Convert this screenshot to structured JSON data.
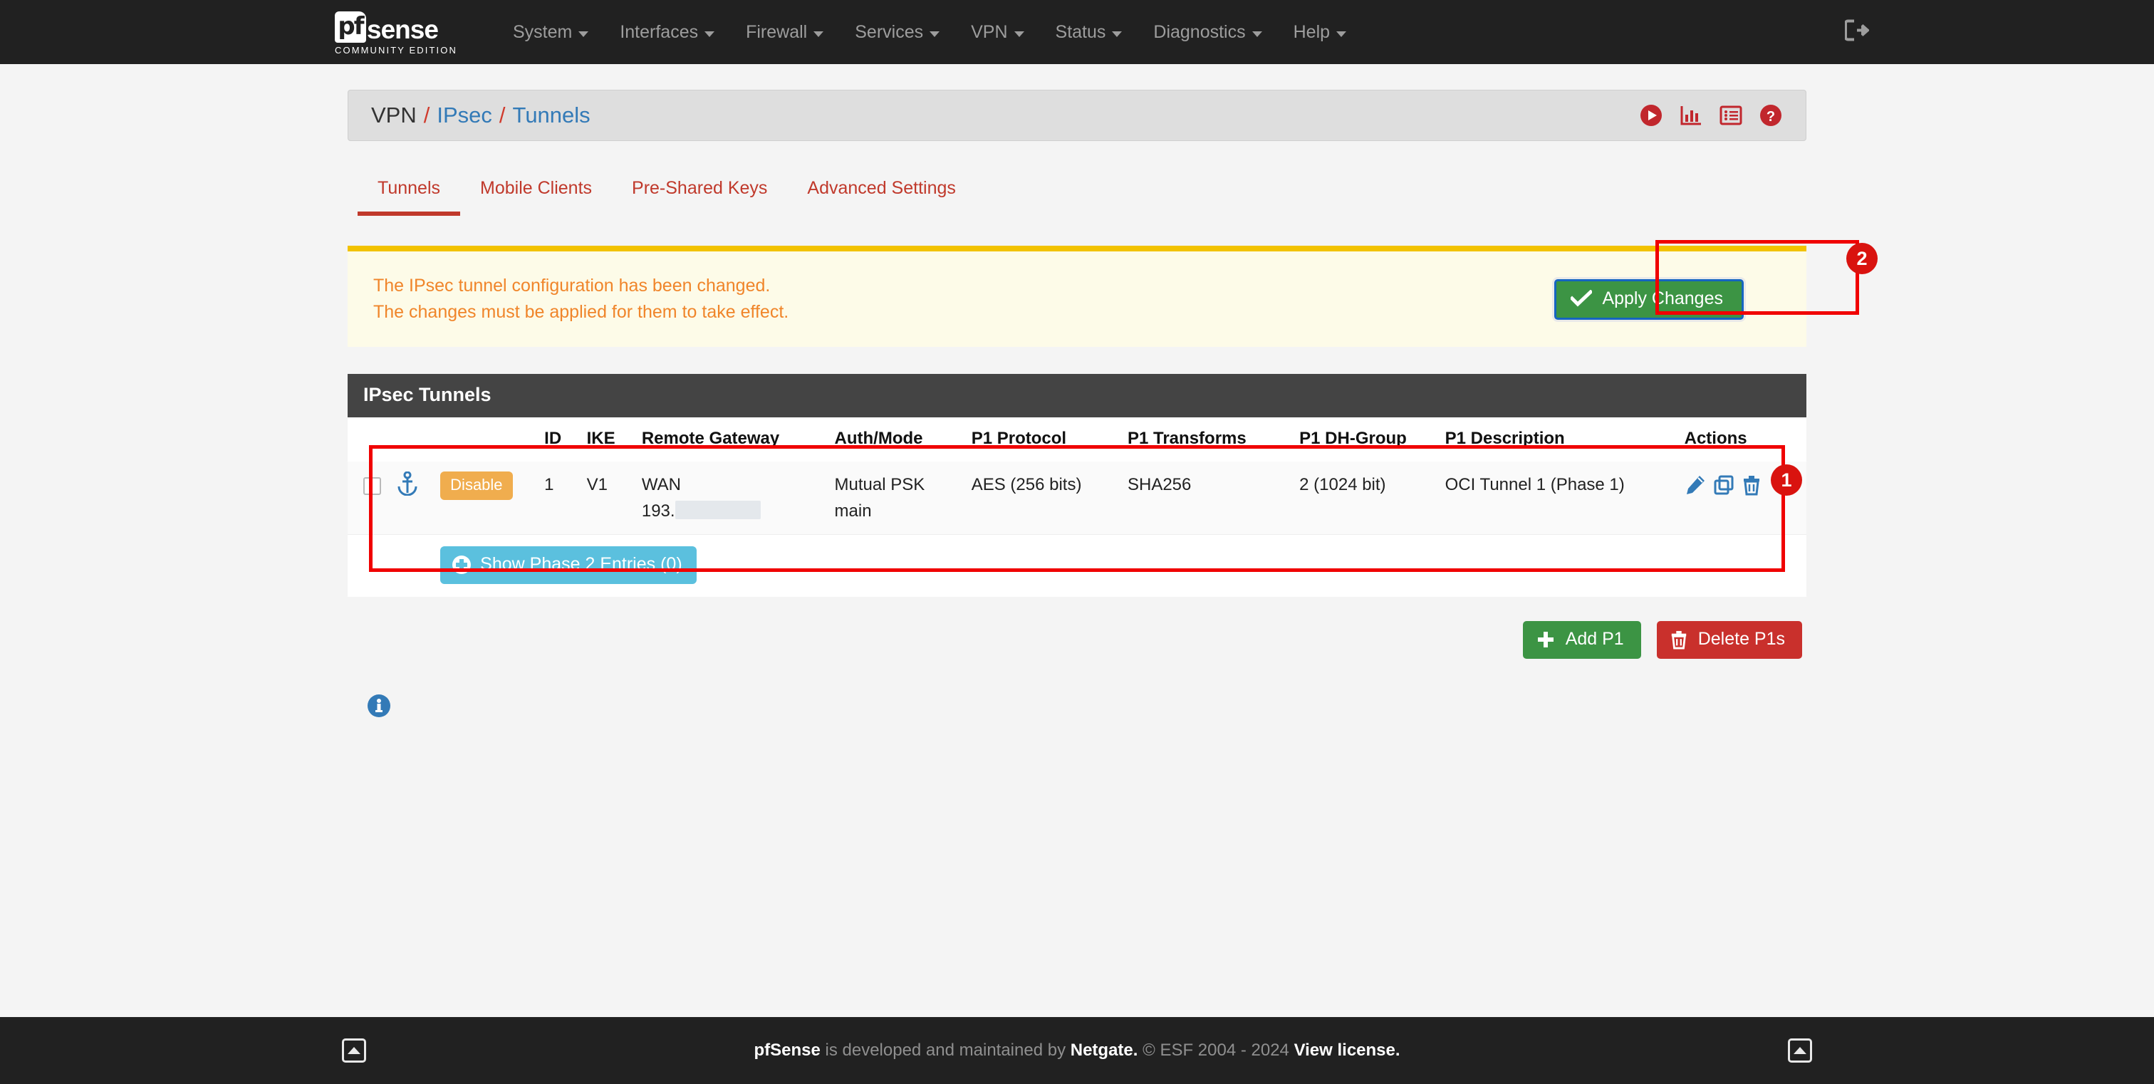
{
  "navbar": {
    "brand_mark": "pf",
    "brand_word": "sense",
    "brand_sub": "COMMUNITY EDITION",
    "logout_icon": "sign-out-icon",
    "items": [
      {
        "label": "System"
      },
      {
        "label": "Interfaces"
      },
      {
        "label": "Firewall"
      },
      {
        "label": "Services"
      },
      {
        "label": "VPN"
      },
      {
        "label": "Status"
      },
      {
        "label": "Diagnostics"
      },
      {
        "label": "Help"
      }
    ]
  },
  "header": {
    "crumb_root": "VPN",
    "crumb_mid": "IPsec",
    "crumb_leaf": "Tunnels",
    "separator": "/",
    "icons": [
      {
        "name": "play-circle-icon"
      },
      {
        "name": "bar-chart-icon"
      },
      {
        "name": "logs-list-icon"
      },
      {
        "name": "help-circle-icon"
      }
    ]
  },
  "tabs": [
    {
      "label": "Tunnels",
      "active": true
    },
    {
      "label": "Mobile Clients",
      "active": false
    },
    {
      "label": "Pre-Shared Keys",
      "active": false
    },
    {
      "label": "Advanced Settings",
      "active": false
    }
  ],
  "alert": {
    "line1": "The IPsec tunnel configuration has been changed.",
    "line2": "The changes must be applied for them to take effect.",
    "apply_label": "Apply Changes",
    "apply_icon": "check-icon"
  },
  "panel": {
    "title": "IPsec Tunnels",
    "columns": [
      "",
      "",
      "",
      "ID",
      "IKE",
      "Remote Gateway",
      "Auth/Mode",
      "P1 Protocol",
      "P1 Transforms",
      "P1 DH-Group",
      "P1 Description",
      "Actions"
    ],
    "rows": [
      {
        "checkbox_name": "row-select-checkbox",
        "status_icon": "anchor-icon",
        "status_badge": "Disable",
        "id": "1",
        "ike": "V1",
        "gateway_interface": "WAN",
        "gateway_address": "193.",
        "gateway_redacted": true,
        "auth": "Mutual PSK",
        "mode": "main",
        "p1_protocol": "AES (256 bits)",
        "p1_transforms": "SHA256",
        "p1_dh_group": "2 (1024 bit)",
        "p1_description": "OCI Tunnel 1 (Phase 1)",
        "actions": [
          {
            "name": "edit-pencil-icon"
          },
          {
            "name": "copy-icon"
          },
          {
            "name": "delete-trash-icon"
          }
        ]
      }
    ],
    "phase2_button_label": "Show Phase 2 Entries (0)",
    "phase2_button_icon": "plus-circle-icon"
  },
  "buttons": {
    "add_label": "Add P1",
    "add_icon": "plus-icon",
    "delete_label": "Delete P1s",
    "delete_icon": "trash-icon"
  },
  "info_icon": "info-circle-icon",
  "annotations": [
    {
      "number": "1"
    },
    {
      "number": "2"
    }
  ],
  "footer": {
    "brand": "pfSense",
    "mid": " is developed and maintained by ",
    "netgate": "Netgate.",
    "copyright": " © ESF 2004 - 2024 ",
    "license": "View license.",
    "left_icon": "collapse-panel-icon",
    "right_icon": "scroll-top-icon"
  },
  "colors": {
    "navbar_bg": "#212121",
    "accent_red": "#c0392b",
    "link_blue": "#337ab7",
    "success_green": "#3c9444",
    "danger_red": "#c9302c",
    "warning_orange": "#f0ad4e",
    "info_blue": "#5bc0de",
    "alert_text": "#f0852a",
    "annotation_red": "#d9130f"
  }
}
